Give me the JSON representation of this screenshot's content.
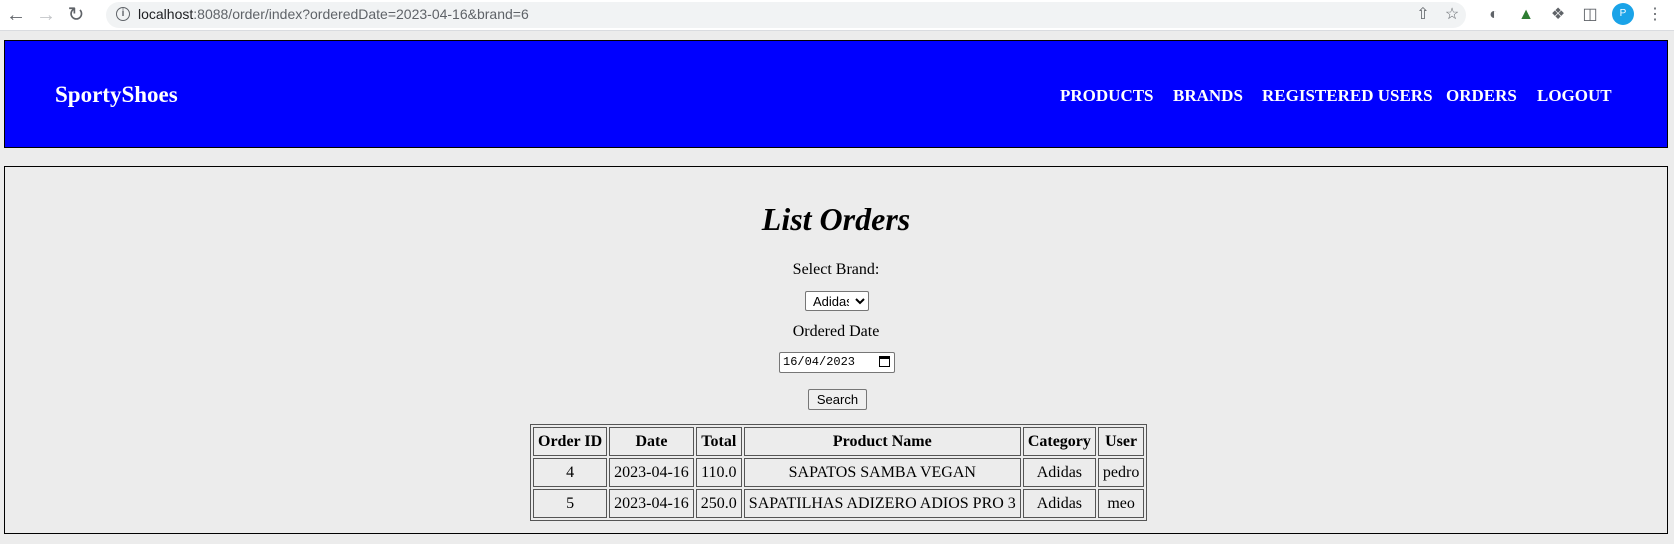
{
  "browser": {
    "url_host": "localhost",
    "url_rest": ":8088/order/index?orderedDate=2023-04-16&brand=6",
    "profile_initial": "P"
  },
  "header": {
    "brand": "SportyShoes",
    "nav": [
      "PRODUCTS",
      "BRANDS",
      "REGISTERED USERS",
      "ORDERS",
      "LOGOUT"
    ],
    "bg_color": "#0000ff"
  },
  "main": {
    "title": "List Orders",
    "brand_label": "Select Brand:",
    "brand_selected": "Adidas",
    "date_label": "Ordered Date",
    "date_value": "16/04/2023",
    "search_label": "Search"
  },
  "table": {
    "headers": [
      "Order ID",
      "Date",
      "Total",
      "Product Name",
      "Category",
      "User"
    ],
    "rows": [
      [
        "4",
        "2023-04-16",
        "110.0",
        "SAPATOS SAMBA VEGAN",
        "Adidas",
        "pedro"
      ],
      [
        "5",
        "2023-04-16",
        "250.0",
        "SAPATILHAS ADIZERO ADIOS PRO 3",
        "Adidas",
        "meo"
      ]
    ]
  }
}
